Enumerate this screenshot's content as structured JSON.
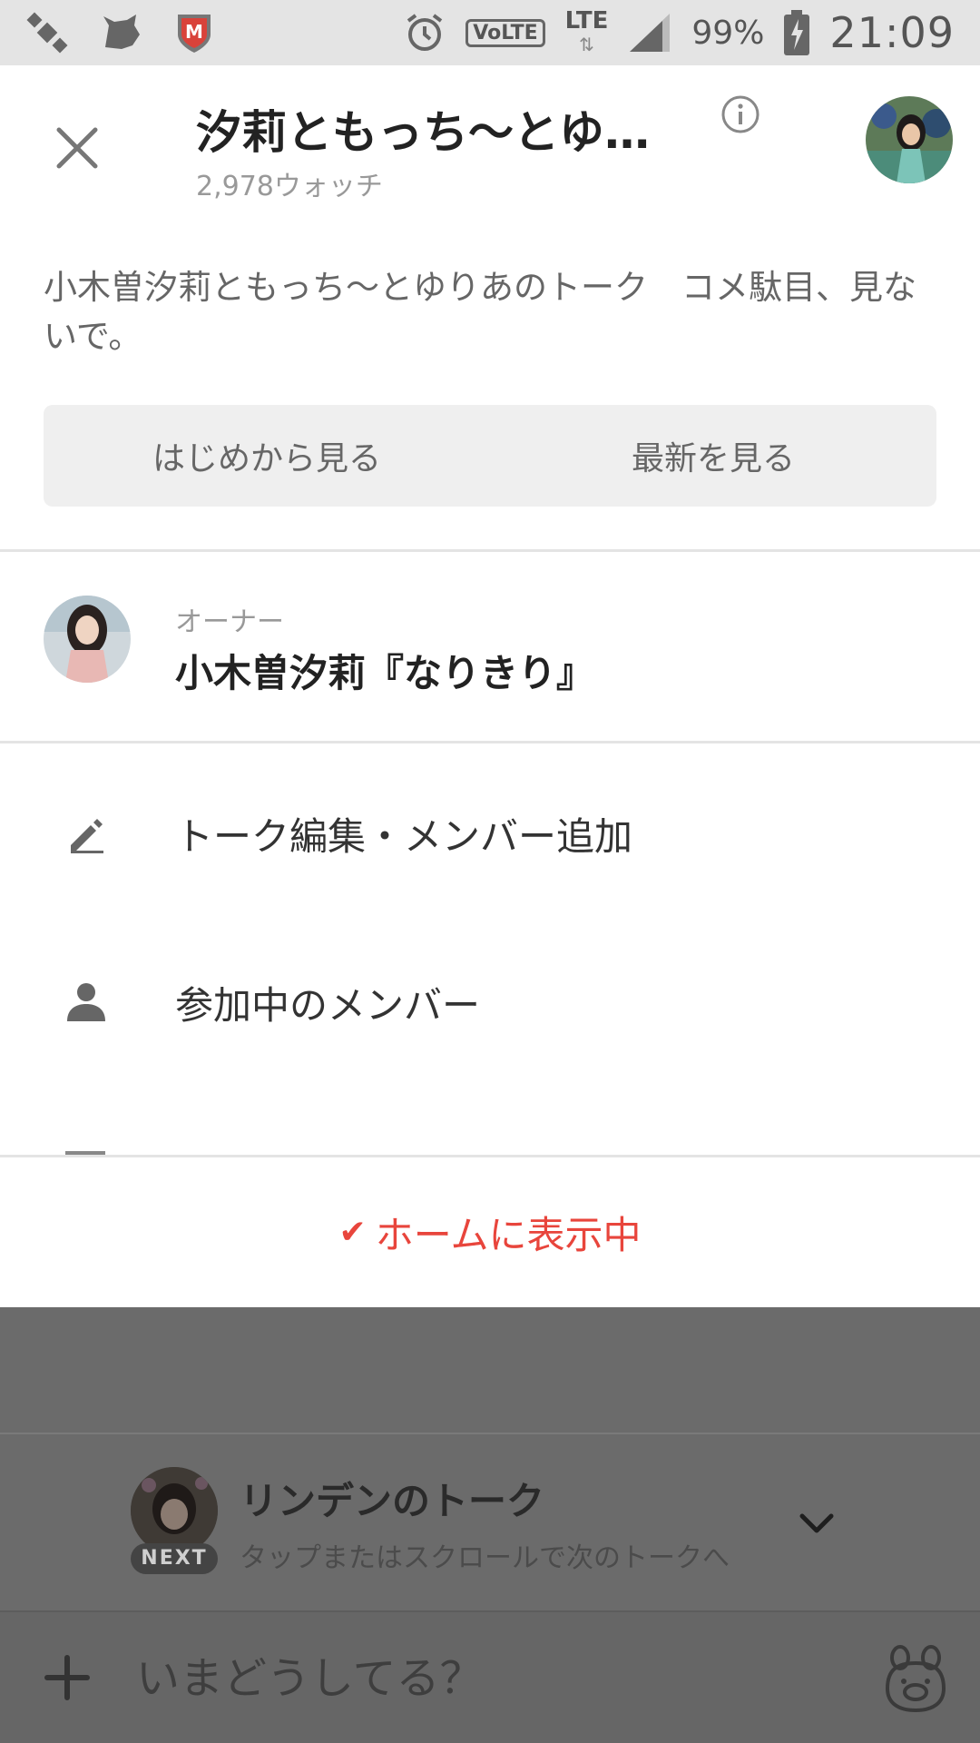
{
  "status_bar": {
    "lte_label": "LTE",
    "volte_label": "VoLTE",
    "battery_pct": "99%",
    "time": "21:09",
    "icons": [
      "satellite-icon",
      "pet-icon",
      "mcafee-icon",
      "alarm-icon",
      "volte-icon",
      "lte-icon",
      "signal-icon",
      "battery-icon"
    ]
  },
  "header": {
    "title": "汐莉ともっち〜とゆり…",
    "watch_count": "2,978ウォッチ"
  },
  "description": "小木曽汐莉ともっち〜とゆりあのトーク　コメ駄目、見ないで。",
  "view_buttons": {
    "from_start": "はじめから見る",
    "latest": "最新を見る"
  },
  "owner": {
    "label": "オーナー",
    "name": "小木曽汐莉『なりきり』"
  },
  "menu": {
    "items": [
      {
        "label": "トーク編集・メンバー追加",
        "icon": "pencil-icon"
      },
      {
        "label": "参加中のメンバー",
        "icon": "person-icon"
      }
    ]
  },
  "home_status": {
    "label": "ホームに表示中",
    "color": "#e8453c"
  },
  "next_talk": {
    "badge": "NEXT",
    "title": "リンデンのトーク",
    "subtitle": "タップまたはスクロールで次のトークへ"
  },
  "composer": {
    "placeholder": "いまどうしてる？"
  }
}
